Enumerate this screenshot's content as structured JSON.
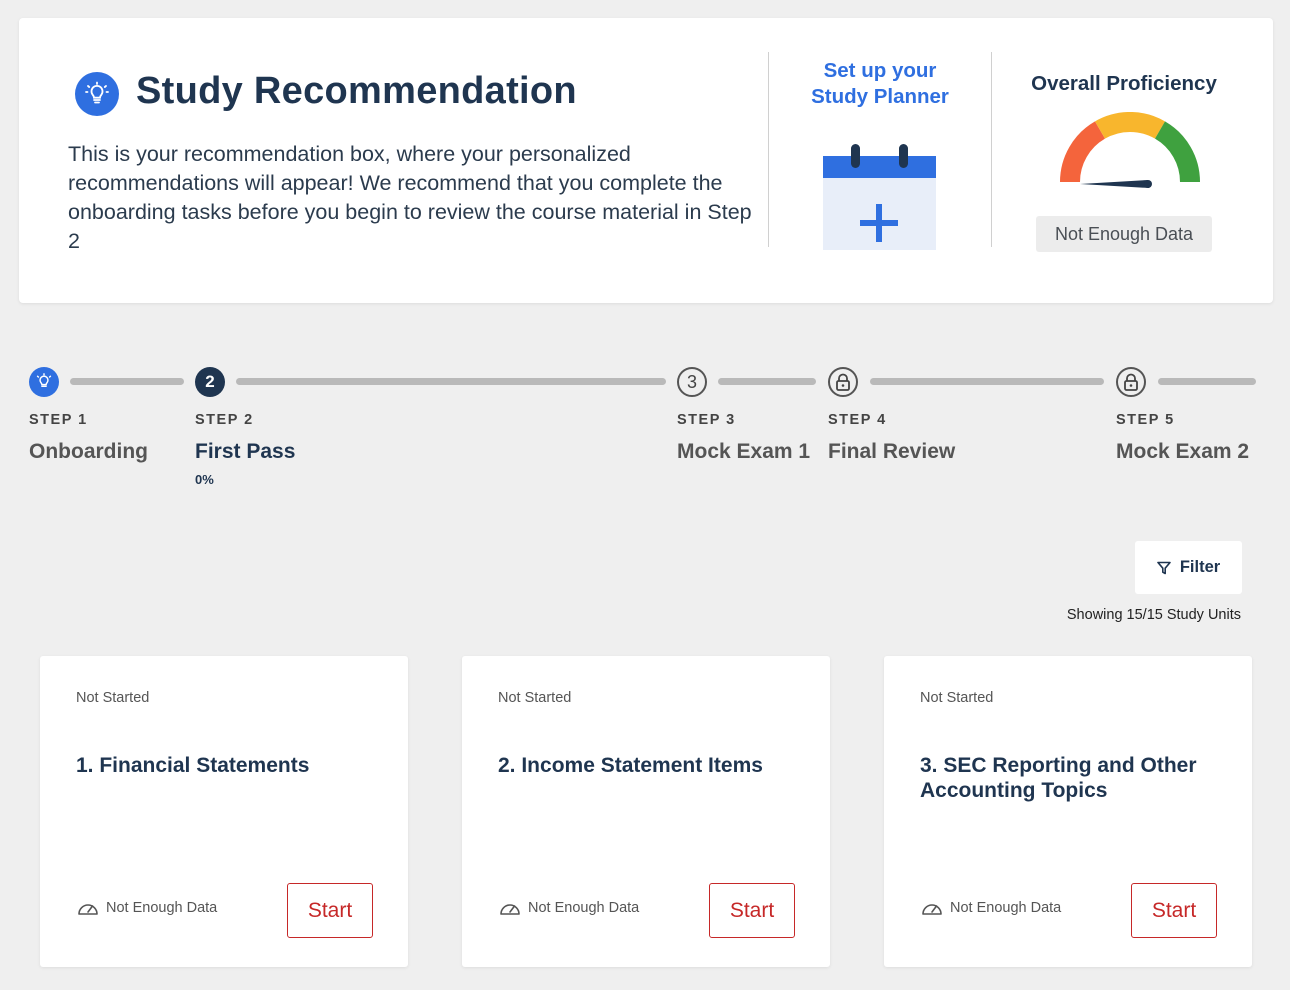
{
  "recommendation": {
    "title": "Study Recommendation",
    "description": "This is your recommendation box, where your personalized recommendations will appear! We recommend that you complete the onboarding tasks before you begin to review the course material in Step 2",
    "planner_line1": "Set up your",
    "planner_line2": "Study Planner",
    "proficiency_title": "Overall Proficiency",
    "proficiency_status": "Not Enough Data"
  },
  "steps": [
    {
      "label": "STEP 1",
      "name": "Onboarding",
      "icon": "lightbulb-icon"
    },
    {
      "label": "STEP 2",
      "name": "First Pass",
      "number": "2",
      "progress": "0%"
    },
    {
      "label": "STEP 3",
      "name": "Mock Exam 1",
      "number": "3"
    },
    {
      "label": "STEP 4",
      "name": "Final Review",
      "icon": "lock-icon"
    },
    {
      "label": "STEP 5",
      "name": "Mock Exam 2",
      "icon": "lock-icon"
    }
  ],
  "filter": {
    "label": "Filter",
    "showing": "Showing 15/15 Study Units"
  },
  "units": [
    {
      "status": "Not Started",
      "title": "1. Financial Statements",
      "data": "Not Enough Data",
      "action": "Start"
    },
    {
      "status": "Not Started",
      "title": "2. Income Statement Items",
      "data": "Not Enough Data",
      "action": "Start"
    },
    {
      "status": "Not Started",
      "title": "3. SEC Reporting and Other Accounting Topics",
      "data": "Not Enough Data",
      "action": "Start"
    }
  ],
  "colors": {
    "primary": "#2f6fe0",
    "navy": "#1f3550",
    "start_red": "#c62828",
    "gauge_red": "#f4643c",
    "gauge_yellow": "#f8b62d",
    "gauge_green": "#3fa13f"
  }
}
